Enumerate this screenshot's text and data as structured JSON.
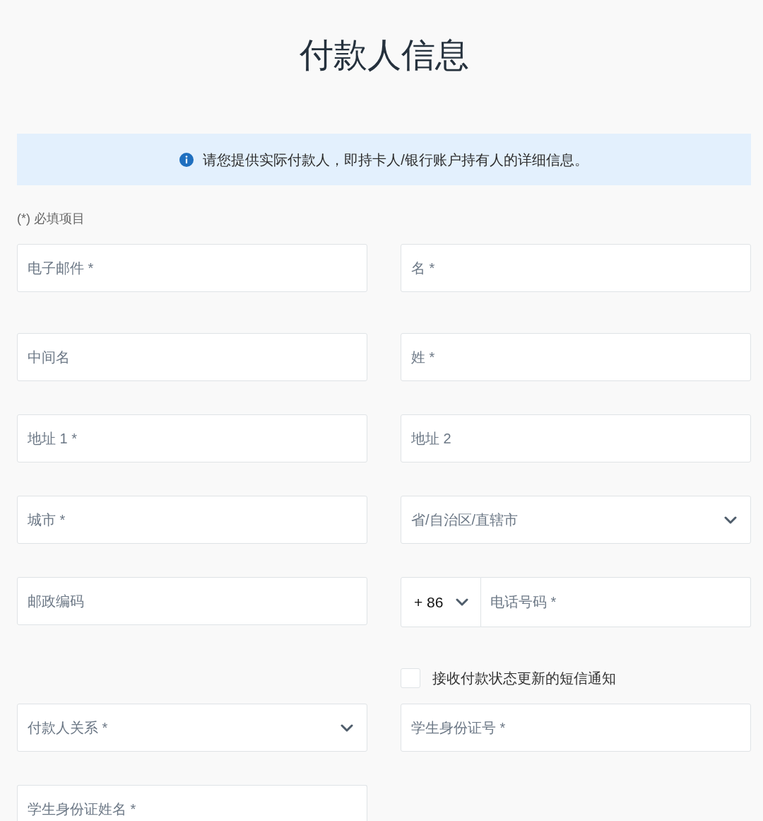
{
  "title": "付款人信息",
  "notice": {
    "text": "请您提供实际付款人，即持卡人/银行账户持有人的详细信息。"
  },
  "required_note": "(*) 必填项目",
  "fields": [
    {
      "kind": "text",
      "placeholder": "电子邮件 *"
    },
    {
      "kind": "text",
      "placeholder": "名 *"
    },
    {
      "kind": "text",
      "placeholder": "中间名"
    },
    {
      "kind": "text",
      "placeholder": "姓 *"
    },
    {
      "kind": "text",
      "placeholder": "地址 1 *"
    },
    {
      "kind": "text",
      "placeholder": "地址 2"
    },
    {
      "kind": "text",
      "placeholder": "城市 *"
    },
    {
      "kind": "select",
      "placeholder": "省/自治区/直辖市"
    },
    {
      "kind": "text",
      "placeholder": "邮政编码"
    },
    {
      "kind": "phone",
      "country_code": "+ 86",
      "placeholder": "电话号码 *",
      "sms_option": {
        "label": "接收付款状态更新的短信通知",
        "checked": false
      }
    },
    {
      "kind": "select",
      "placeholder": "付款人关系 *"
    },
    {
      "kind": "text",
      "placeholder": "学生身份证号 *"
    },
    {
      "kind": "text",
      "placeholder": "学生身份证姓名 *"
    }
  ]
}
